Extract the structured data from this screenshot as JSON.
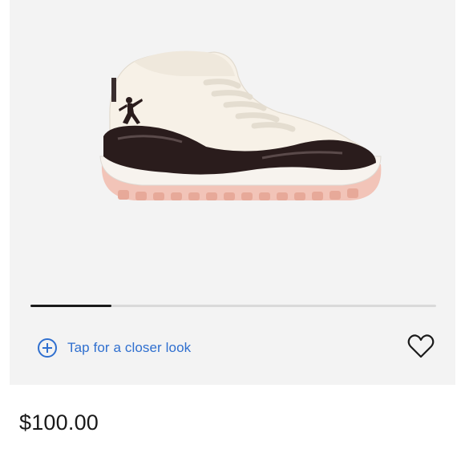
{
  "gallery": {
    "image_alt": "Jordan 11 Retro sneaker, white and black patent leather with pink outsole",
    "progress_fraction": 0.2,
    "closer_look_label": "Tap for a closer look",
    "icons": {
      "closer_look": "plus-circle-icon",
      "favorite": "heart-icon"
    }
  },
  "product": {
    "price": "$100.00"
  },
  "colors": {
    "accent": "#2f6fcf",
    "gallery_bg": "#f3f3f3",
    "progress_fill": "#1a1a1a",
    "progress_track": "#d9d9d9"
  }
}
